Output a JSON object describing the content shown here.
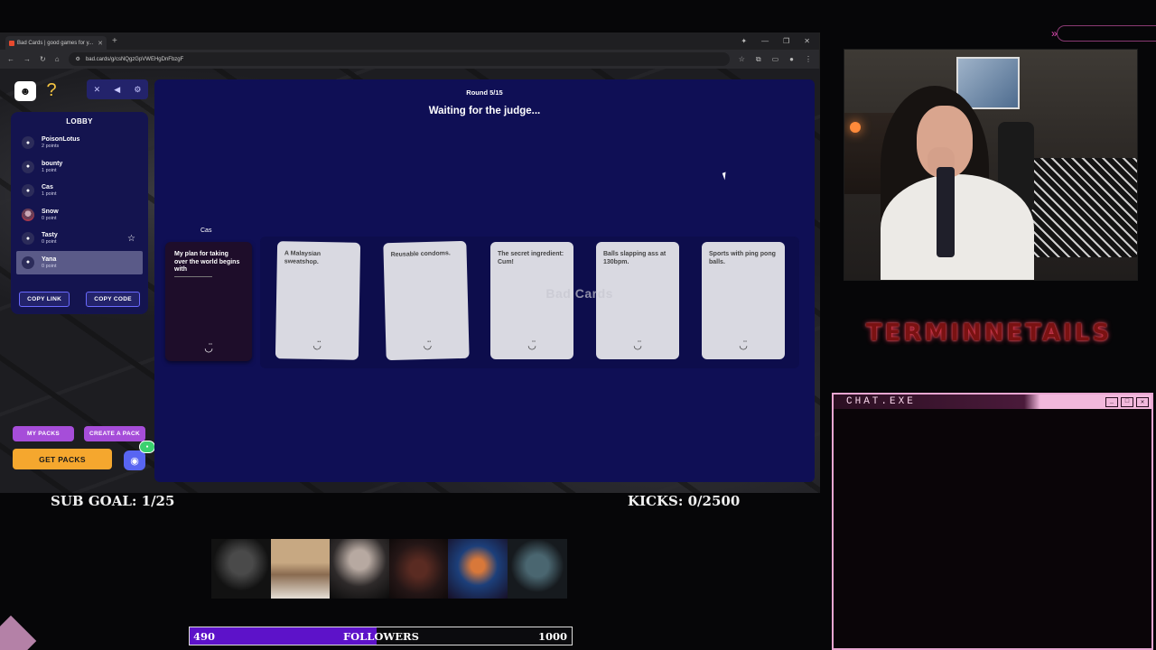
{
  "browser": {
    "tab_title": "Bad Cards | good games for y...",
    "url": "bad.cards/g/csNQgzGpVWEHgDnFbzgF"
  },
  "sidebar": {
    "lobby_title": "LOBBY",
    "players": [
      {
        "name": "PoisonLotus",
        "points": "2 points"
      },
      {
        "name": "bounty",
        "points": "1 point"
      },
      {
        "name": "Cas",
        "points": "1 point"
      },
      {
        "name": "Snow",
        "points": "0 point"
      },
      {
        "name": "Tasty",
        "points": "0 point"
      },
      {
        "name": "Yana",
        "points": "0 point"
      }
    ],
    "copy_link": "COPY LINK",
    "copy_code": "COPY CODE",
    "my_packs": "MY PACKS",
    "create_pack": "CREATE A PACK",
    "get_packs": "GET PACKS"
  },
  "game": {
    "round": "Round 5/15",
    "status": "Waiting for the judge...",
    "czar": "Cas",
    "black_card": "My plan for taking over the world begins with",
    "white_cards": [
      "A Malaysian sweatshop.",
      "Reusable condoms.",
      "The secret ingredient: Cum!",
      "Balls slapping ass at 130bpm.",
      "Sports with ping pong balls."
    ],
    "watermark": "Bad Cards"
  },
  "overlay": {
    "neon_title": "TERMINNETAILS",
    "chat_title": "CHAT.EXE",
    "sub_goal": "SUB GOAL: 1/25",
    "kicks": "KICKS: 0/2500",
    "followers_current": "490",
    "followers_label": "FOLLOWERS",
    "followers_goal": "1000",
    "followers_progress": 0.49
  }
}
